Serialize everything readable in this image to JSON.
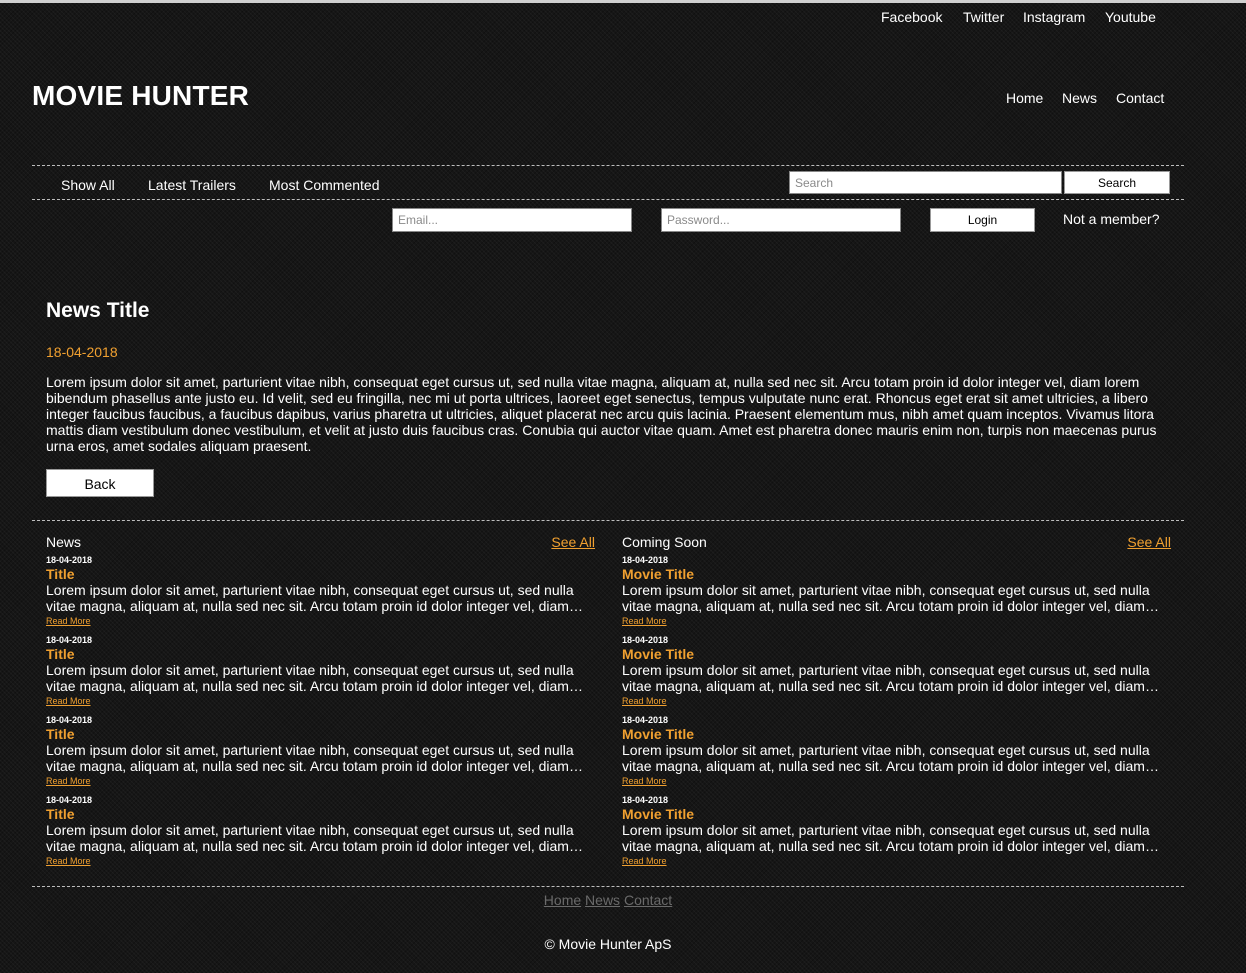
{
  "social": {
    "facebook": "Facebook",
    "twitter": "Twitter",
    "instagram": "Instagram",
    "youtube": "Youtube"
  },
  "brand": "MOVIE HUNTER",
  "main_nav": {
    "home": "Home",
    "news": "News",
    "contact": "Contact"
  },
  "category_nav": {
    "show_all": "Show All",
    "latest_trailers": "Latest Trailers",
    "most_commented": "Most Commented"
  },
  "search": {
    "placeholder": "Search",
    "button": "Search"
  },
  "login": {
    "email_placeholder": "Email...",
    "password_placeholder": "Password...",
    "button": "Login",
    "not_member": "Not a member?"
  },
  "article": {
    "title": "News Title",
    "date": "18-04-2018",
    "body": "Lorem ipsum dolor sit amet, parturient vitae nibh, consequat eget cursus ut, sed nulla vitae magna, aliquam at, nulla sed nec sit. Arcu totam proin id dolor integer vel, diam lorem bibendum phasellus ante justo eu. Id velit, sed eu fringilla, nec mi ut porta ultrices, laoreet eget senectus, tempus vulputate nunc erat. Rhoncus eget erat sit amet ultricies, a libero integer faucibus faucibus, a faucibus dapibus, varius pharetra ut ultricies, aliquet placerat nec arcu quis lacinia. Praesent elementum mus, nibh amet quam inceptos. Vivamus litora mattis diam vestibulum donec vestibulum, et velit at justo duis faucibus cras. Conubia qui auctor vitae quam. Amet est pharetra donec mauris enim non, turpis non maecenas purus urna eros, amet sodales aliquam praesent.",
    "back_button": "Back"
  },
  "news": {
    "heading": "News",
    "see_all": "See All",
    "items": [
      {
        "date": "18-04-2018",
        "title": "Title",
        "text": "Lorem ipsum dolor sit amet, parturient vitae nibh, consequat eget cursus ut, sed nulla vitae magna, aliquam at, nulla sed nec sit. Arcu totam proin id dolor integer vel, diam lorem bibendum phasellus ante justo eu.",
        "more": "Read More"
      },
      {
        "date": "18-04-2018",
        "title": "Title",
        "text": "Lorem ipsum dolor sit amet, parturient vitae nibh, consequat eget cursus ut, sed nulla vitae magna, aliquam at, nulla sed nec sit. Arcu totam proin id dolor integer vel, diam lorem bibendum phasellus ante justo eu.",
        "more": "Read More"
      },
      {
        "date": "18-04-2018",
        "title": "Title",
        "text": "Lorem ipsum dolor sit amet, parturient vitae nibh, consequat eget cursus ut, sed nulla vitae magna, aliquam at, nulla sed nec sit. Arcu totam proin id dolor integer vel, diam lorem bibendum phasellus ante justo eu.",
        "more": "Read More"
      },
      {
        "date": "18-04-2018",
        "title": "Title",
        "text": "Lorem ipsum dolor sit amet, parturient vitae nibh, consequat eget cursus ut, sed nulla vitae magna, aliquam at, nulla sed nec sit. Arcu totam proin id dolor integer vel, diam lorem bibendum phasellus ante justo eu.",
        "more": "Read More"
      }
    ]
  },
  "coming_soon": {
    "heading": "Coming Soon",
    "see_all": "See All",
    "items": [
      {
        "date": "18-04-2018",
        "title": "Movie Title",
        "text": "Lorem ipsum dolor sit amet, parturient vitae nibh, consequat eget cursus ut, sed nulla vitae magna, aliquam at, nulla sed nec sit. Arcu totam proin id dolor integer vel, diam lorem bibendum phasellus ante justo eu.",
        "more": "Read More"
      },
      {
        "date": "18-04-2018",
        "title": "Movie Title",
        "text": "Lorem ipsum dolor sit amet, parturient vitae nibh, consequat eget cursus ut, sed nulla vitae magna, aliquam at, nulla sed nec sit. Arcu totam proin id dolor integer vel, diam lorem bibendum phasellus ante justo eu.",
        "more": "Read More"
      },
      {
        "date": "18-04-2018",
        "title": "Movie Title",
        "text": "Lorem ipsum dolor sit amet, parturient vitae nibh, consequat eget cursus ut, sed nulla vitae magna, aliquam at, nulla sed nec sit. Arcu totam proin id dolor integer vel, diam lorem bibendum phasellus ante justo eu.",
        "more": "Read More"
      },
      {
        "date": "18-04-2018",
        "title": "Movie Title",
        "text": "Lorem ipsum dolor sit amet, parturient vitae nibh, consequat eget cursus ut, sed nulla vitae magna, aliquam at, nulla sed nec sit. Arcu totam proin id dolor integer vel, diam lorem bibendum phasellus ante justo eu.",
        "more": "Read More"
      }
    ]
  },
  "footer": {
    "links": {
      "home": "Home",
      "news": "News",
      "contact": "Contact"
    },
    "copyright": "© Movie Hunter ApS"
  },
  "colors": {
    "accent": "#f0a030",
    "background": "#161616",
    "footer_link": "#6a6a6a"
  }
}
